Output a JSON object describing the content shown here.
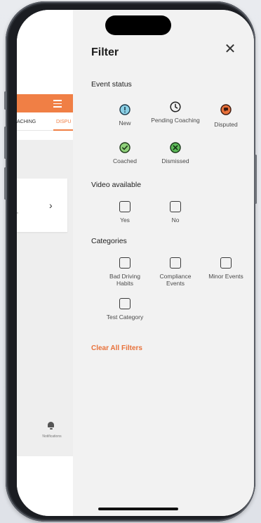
{
  "background_app": {
    "tabs": [
      "ACHING",
      "DISPU"
    ],
    "notifications_label": "Notifications"
  },
  "filter": {
    "title": "Filter",
    "event_status": {
      "heading": "Event status",
      "options": [
        {
          "label": "New",
          "icon": "exclamation-circle-icon",
          "color": "#4aa7c7"
        },
        {
          "label": "Pending Coaching",
          "icon": "clock-icon",
          "color": "#333333"
        },
        {
          "label": "Disputed",
          "icon": "dispute-chat-icon",
          "color": "#e8713a"
        },
        {
          "label": "Coached",
          "icon": "check-circle-icon",
          "color": "#5cb85c"
        },
        {
          "label": "Dismissed",
          "icon": "x-circle-icon",
          "color": "#47a447"
        }
      ]
    },
    "video_available": {
      "heading": "Video available",
      "options": [
        {
          "label": "Yes"
        },
        {
          "label": "No"
        }
      ]
    },
    "categories": {
      "heading": "Categories",
      "options": [
        {
          "label": "Bad Driving Habits"
        },
        {
          "label": "Compliance Events"
        },
        {
          "label": "Minor Events"
        },
        {
          "label": "Test Category"
        }
      ]
    },
    "clear_all_label": "Clear All Filters"
  },
  "colors": {
    "accent": "#e8713a",
    "panel_bg": "#f2f2f2"
  }
}
